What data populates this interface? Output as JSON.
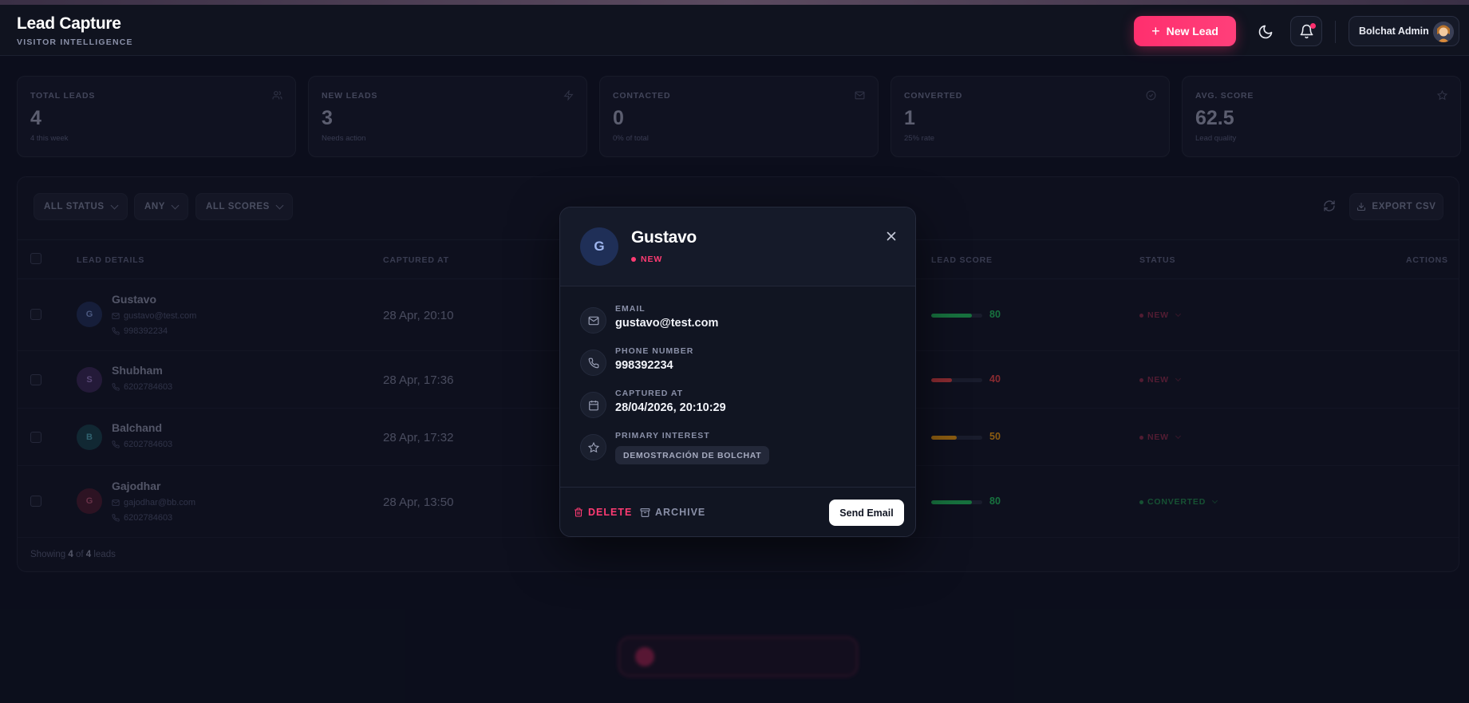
{
  "header": {
    "title": "Lead Capture",
    "subtitle": "VISITOR INTELLIGENCE",
    "new_lead_label": "New Lead",
    "user_name": "Bolchat Admin"
  },
  "stats": [
    {
      "label": "TOTAL LEADS",
      "value": "4",
      "sub": "4 this week",
      "icon": "users-icon"
    },
    {
      "label": "NEW LEADS",
      "value": "3",
      "sub": "Needs action",
      "icon": "bolt-icon"
    },
    {
      "label": "CONTACTED",
      "value": "0",
      "sub": "0% of total",
      "icon": "mail-icon"
    },
    {
      "label": "CONVERTED",
      "value": "1",
      "sub": "25% rate",
      "icon": "check-circle-icon"
    },
    {
      "label": "AVG. SCORE",
      "value": "62.5",
      "sub": "Lead quality",
      "icon": "star-icon"
    }
  ],
  "filters": {
    "status": "ALL STATUS",
    "time": "ANY",
    "scores": "ALL SCORES",
    "export_label": "EXPORT CSV"
  },
  "table": {
    "columns": {
      "lead": "LEAD DETAILS",
      "captured": "CAPTURED AT",
      "score": "LEAD SCORE",
      "status": "STATUS",
      "actions": "ACTIONS"
    },
    "rows": [
      {
        "initial": "G",
        "name": "Gustavo",
        "email": "gustavo@test.com",
        "phone": "998392234",
        "captured": "28 Apr, 20:10",
        "score": 80,
        "score_label": "80",
        "status": "NEW"
      },
      {
        "initial": "S",
        "name": "Shubham",
        "email": "",
        "phone": "6202784603",
        "captured": "28 Apr, 17:36",
        "score": 40,
        "score_label": "40",
        "status": "NEW"
      },
      {
        "initial": "B",
        "name": "Balchand",
        "email": "",
        "phone": "6202784603",
        "captured": "28 Apr, 17:32",
        "score": 50,
        "score_label": "50",
        "status": "NEW"
      },
      {
        "initial": "G",
        "name": "Gajodhar",
        "email": "gajodhar@bb.com",
        "phone": "6202784603",
        "captured": "28 Apr, 13:50",
        "score": 80,
        "score_label": "80",
        "status": "CONVERTED"
      }
    ],
    "footer": {
      "prefix": "Showing",
      "shown": "4",
      "of": "of",
      "total": "4",
      "suffix": "leads"
    }
  },
  "modal": {
    "initial": "G",
    "name": "Gustavo",
    "status": "NEW",
    "email_label": "EMAIL",
    "email": "gustavo@test.com",
    "phone_label": "PHONE NUMBER",
    "phone": "998392234",
    "captured_label": "CAPTURED AT",
    "captured": "28/04/2026, 20:10:29",
    "interest_label": "PRIMARY INTEREST",
    "interest": "DEMOSTRACIÓN DE BOLCHAT",
    "delete_label": "DELETE",
    "archive_label": "ARCHIVE",
    "send_label": "Send Email"
  },
  "colors": {
    "accent": "#ff2f6e",
    "score_high": "#22c55e",
    "score_low": "#ef4444",
    "score_mid": "#f59e0b",
    "status_new": "#ff3b73",
    "status_converted": "#22c55e"
  }
}
